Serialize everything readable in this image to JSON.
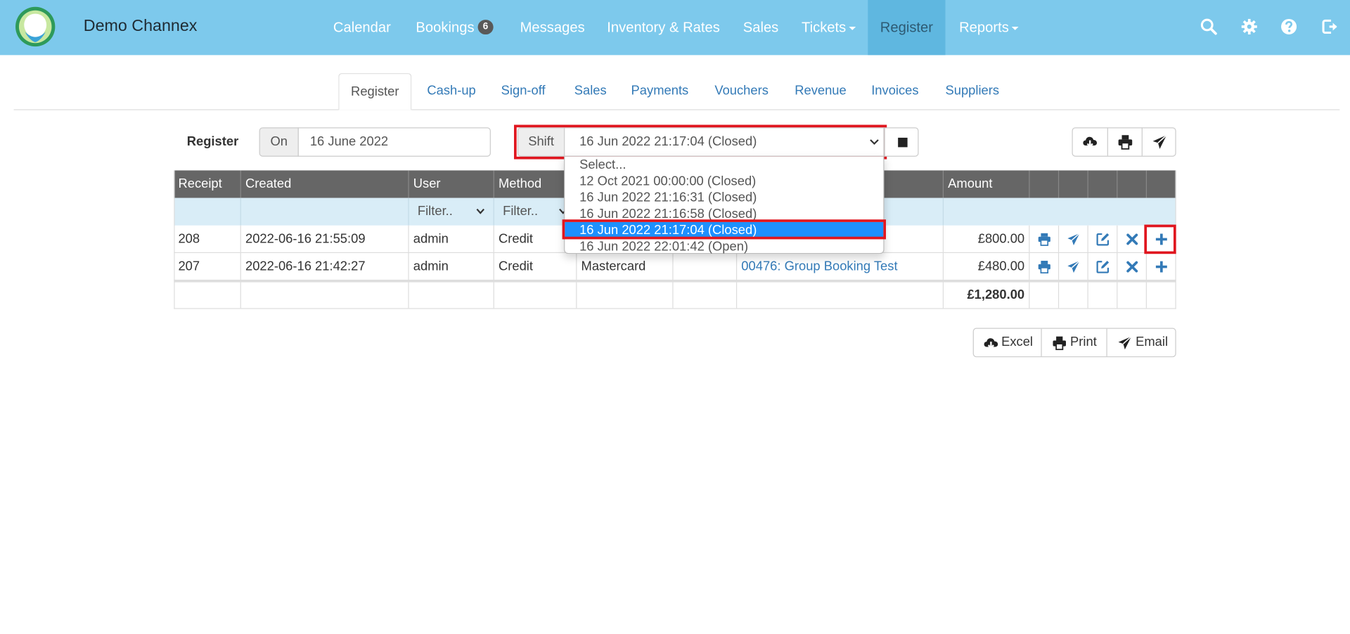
{
  "colors": {
    "navbar": "#7dc9ec",
    "nav_active": "#5fb7e0",
    "link": "#337ab7",
    "header_row": "#666666",
    "filter_row": "#d9edf7",
    "highlight": "#e0161f",
    "option_selected": "#1e90ff"
  },
  "brand": {
    "name": "Demo Channex",
    "logo_icon": "channex-logo-icon"
  },
  "nav": {
    "calendar": "Calendar",
    "bookings": "Bookings",
    "bookings_badge": "6",
    "messages": "Messages",
    "inventory": "Inventory & Rates",
    "sales": "Sales",
    "tickets": "Tickets",
    "register": "Register",
    "reports": "Reports",
    "icons": [
      "search-icon",
      "gear-icon",
      "help-icon",
      "logout-icon"
    ]
  },
  "tabs": {
    "register": "Register",
    "cashup": "Cash-up",
    "signoff": "Sign-off",
    "sales": "Sales",
    "payments": "Payments",
    "vouchers": "Vouchers",
    "revenue": "Revenue",
    "invoices": "Invoices",
    "suppliers": "Suppliers"
  },
  "register": {
    "label": "Register",
    "on_label": "On",
    "date_value": "16 June 2022",
    "shift_label": "Shift",
    "shift_value": "16 Jun 2022 21:17:04 (Closed)",
    "shift_options": [
      "Select...",
      "12 Oct 2021 00:00:00 (Closed)",
      "16 Jun 2022 21:16:31 (Closed)",
      "16 Jun 2022 21:16:58 (Closed)",
      "16 Jun 2022 21:17:04 (Closed)",
      "16 Jun 2022 22:01:42 (Open)"
    ],
    "selected_option_index": 4
  },
  "table": {
    "columns": [
      "Receipt",
      "Created",
      "User",
      "Method",
      "",
      "",
      "",
      "Amount"
    ],
    "filter_placeholder": "Filter..",
    "rows": [
      {
        "receipt": "208",
        "created": "2022-06-16 21:55:09",
        "user": "admin",
        "method": "Credit",
        "card": "",
        "ref": "",
        "booking": "",
        "amount": "£800.00"
      },
      {
        "receipt": "207",
        "created": "2022-06-16 21:42:27",
        "user": "admin",
        "method": "Credit",
        "card": "Mastercard",
        "ref": "",
        "booking": "00476: Group Booking Test",
        "amount": "£480.00"
      }
    ],
    "total": "£1,280.00",
    "row_action_icons": [
      "print-icon",
      "send-icon",
      "edit-icon",
      "delete-icon",
      "add-icon"
    ]
  },
  "export": {
    "excel": "Excel",
    "print": "Print",
    "email": "Email"
  }
}
